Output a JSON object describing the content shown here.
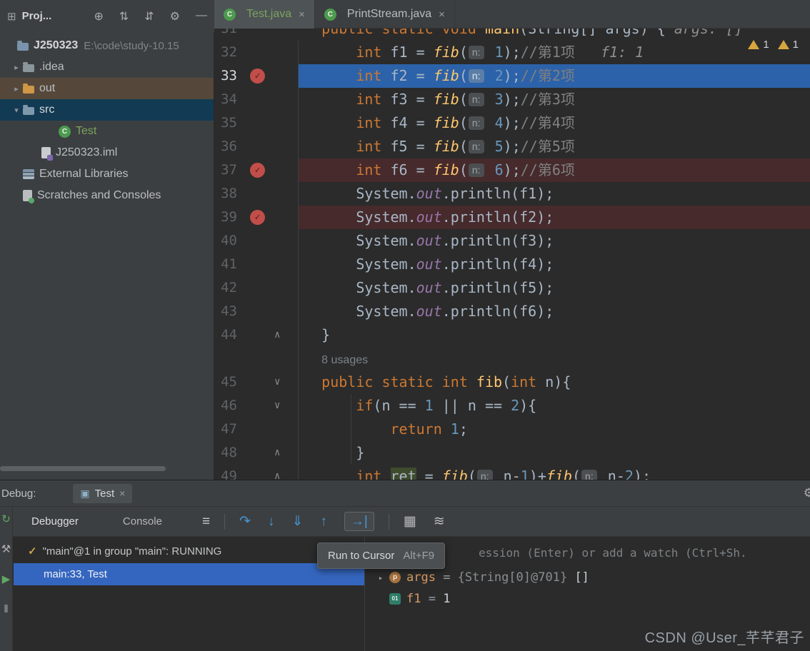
{
  "window": {
    "proj_glyph": "⊞",
    "proj_title": "Proj...",
    "proj_icons": [
      {
        "name": "locate-file-icon",
        "glyph": "⊕"
      },
      {
        "name": "expand-all-icon",
        "glyph": "⇅"
      },
      {
        "name": "collapse-all-icon",
        "glyph": "⇵"
      },
      {
        "name": "settings-gear-icon",
        "glyph": "⚙"
      },
      {
        "name": "hide-panel-icon",
        "glyph": "—"
      }
    ]
  },
  "project": {
    "rows": [
      {
        "id": "root",
        "indent": 6,
        "chevron": "",
        "icon": "folder",
        "iconColor": "#7a93ad",
        "label": "J250323",
        "labelClass": "root",
        "extra": "E:\\code\\study-10.15"
      },
      {
        "id": "idea",
        "indent": 14,
        "chevron": "▸",
        "icon": "folder",
        "iconColor": "#8a959c",
        "label": ".idea"
      },
      {
        "id": "out",
        "indent": 14,
        "chevron": "▸",
        "icon": "folder",
        "iconColor": "#cf9747",
        "label": "out",
        "bg": "#55483a"
      },
      {
        "id": "src",
        "indent": 14,
        "chevron": "▾",
        "icon": "folder",
        "iconColor": "#7f98ac",
        "label": "src",
        "bg": "#123a52",
        "labelColor": "#d8dadc"
      },
      {
        "id": "test-class",
        "indent": 64,
        "chevron": "",
        "icon": "class",
        "label": "Test",
        "labelColor": "#7ba45c"
      },
      {
        "id": "iml-file",
        "indent": 40,
        "chevron": "",
        "icon": "iml",
        "label": "J250323.iml"
      },
      {
        "id": "external-libraries",
        "indent": 14,
        "chevron": "",
        "icon": "lib",
        "label": "External Libraries"
      },
      {
        "id": "scratches",
        "indent": 14,
        "chevron": "",
        "icon": "scratch",
        "label": "Scratches and Consoles"
      }
    ]
  },
  "tabs": [
    {
      "label": "Test.java",
      "active": true,
      "labelColor": "#7ba45c"
    },
    {
      "label": "PrintStream.java",
      "active": false,
      "labelColor": "#b7bcc0"
    }
  ],
  "editor": {
    "close_glyph": "×",
    "inspections": [
      {
        "count": "1"
      },
      {
        "count": "1"
      }
    ],
    "lines": [
      {
        "num": "31",
        "tokens": [
          [
            "    ",
            "pl"
          ],
          [
            "public static void ",
            "kw"
          ],
          [
            "main",
            "decl"
          ],
          [
            "(String[] args) { ",
            "pl"
          ],
          [
            "args: []",
            "dbg"
          ]
        ]
      },
      {
        "num": "32",
        "tokens": [
          [
            "        ",
            "pl"
          ],
          [
            "int",
            "kw"
          ],
          [
            " f1 = ",
            "pl"
          ],
          [
            "fib",
            "call"
          ],
          [
            "(",
            "pl"
          ],
          [
            "n:",
            "chip"
          ],
          [
            " 1",
            "num"
          ],
          [
            ");",
            "pl"
          ],
          [
            "//第1项",
            "cm"
          ],
          [
            "   ",
            "pl"
          ],
          [
            "f1: 1",
            "dbg"
          ]
        ]
      },
      {
        "num": "33",
        "hl": "exec",
        "bp": true,
        "tokens": [
          [
            "        ",
            "pl"
          ],
          [
            "int",
            "kw"
          ],
          [
            " f2 = ",
            "pl"
          ],
          [
            "fib",
            "call"
          ],
          [
            "(",
            "pl"
          ],
          [
            "n:",
            "chip"
          ],
          [
            " 2",
            "num"
          ],
          [
            ");",
            "pl"
          ],
          [
            "//第2项",
            "cm"
          ]
        ]
      },
      {
        "num": "34",
        "tokens": [
          [
            "        ",
            "pl"
          ],
          [
            "int",
            "kw"
          ],
          [
            " f3 = ",
            "pl"
          ],
          [
            "fib",
            "call"
          ],
          [
            "(",
            "pl"
          ],
          [
            "n:",
            "chip"
          ],
          [
            " 3",
            "num"
          ],
          [
            ");",
            "pl"
          ],
          [
            "//第3项",
            "cm"
          ]
        ]
      },
      {
        "num": "35",
        "tokens": [
          [
            "        ",
            "pl"
          ],
          [
            "int",
            "kw"
          ],
          [
            " f4 = ",
            "pl"
          ],
          [
            "fib",
            "call"
          ],
          [
            "(",
            "pl"
          ],
          [
            "n:",
            "chip"
          ],
          [
            " 4",
            "num"
          ],
          [
            ");",
            "pl"
          ],
          [
            "//第4项",
            "cm"
          ]
        ]
      },
      {
        "num": "36",
        "tokens": [
          [
            "        ",
            "pl"
          ],
          [
            "int",
            "kw"
          ],
          [
            " f5 = ",
            "pl"
          ],
          [
            "fib",
            "call"
          ],
          [
            "(",
            "pl"
          ],
          [
            "n:",
            "chip"
          ],
          [
            " 5",
            "num"
          ],
          [
            ");",
            "pl"
          ],
          [
            "//第5项",
            "cm"
          ]
        ]
      },
      {
        "num": "37",
        "hl": "bp",
        "bp": true,
        "tokens": [
          [
            "        ",
            "pl"
          ],
          [
            "int",
            "kw"
          ],
          [
            " f6 = ",
            "pl"
          ],
          [
            "fib",
            "call"
          ],
          [
            "(",
            "pl"
          ],
          [
            "n:",
            "chip"
          ],
          [
            " 6",
            "num"
          ],
          [
            ");",
            "pl"
          ],
          [
            "//第6项",
            "cm"
          ]
        ]
      },
      {
        "num": "38",
        "tokens": [
          [
            "        ",
            "pl"
          ],
          [
            "System.",
            "pl"
          ],
          [
            "out",
            "field"
          ],
          [
            ".println(f1);",
            "pl"
          ]
        ]
      },
      {
        "num": "39",
        "hl": "bp",
        "bp": true,
        "tokens": [
          [
            "        ",
            "pl"
          ],
          [
            "System.",
            "pl"
          ],
          [
            "out",
            "field"
          ],
          [
            ".println(f2);",
            "pl"
          ]
        ]
      },
      {
        "num": "40",
        "tokens": [
          [
            "        ",
            "pl"
          ],
          [
            "System.",
            "pl"
          ],
          [
            "out",
            "field"
          ],
          [
            ".println(f3);",
            "pl"
          ]
        ]
      },
      {
        "num": "41",
        "tokens": [
          [
            "        ",
            "pl"
          ],
          [
            "System.",
            "pl"
          ],
          [
            "out",
            "field"
          ],
          [
            ".println(f4);",
            "pl"
          ]
        ]
      },
      {
        "num": "42",
        "tokens": [
          [
            "        ",
            "pl"
          ],
          [
            "System.",
            "pl"
          ],
          [
            "out",
            "field"
          ],
          [
            ".println(f5);",
            "pl"
          ]
        ]
      },
      {
        "num": "43",
        "tokens": [
          [
            "        ",
            "pl"
          ],
          [
            "System.",
            "pl"
          ],
          [
            "out",
            "field"
          ],
          [
            ".println(f6);",
            "pl"
          ]
        ]
      },
      {
        "num": "44",
        "fold": "end",
        "tokens": [
          [
            "    }",
            "pl"
          ]
        ]
      },
      {
        "num": "",
        "tokens": [
          [
            "    ",
            "pl"
          ],
          [
            "8 usages",
            "usages"
          ]
        ]
      },
      {
        "num": "45",
        "fold": "start",
        "tokens": [
          [
            "    ",
            "pl"
          ],
          [
            "public static int ",
            "kw"
          ],
          [
            "fib",
            "decl"
          ],
          [
            "(",
            "pl"
          ],
          [
            "int",
            "kw"
          ],
          [
            " n){",
            "pl"
          ]
        ]
      },
      {
        "num": "46",
        "fold": "start",
        "tokens": [
          [
            "        ",
            "pl"
          ],
          [
            "if",
            "kw"
          ],
          [
            "(n == ",
            "pl"
          ],
          [
            "1",
            "num"
          ],
          [
            " || n == ",
            "pl"
          ],
          [
            "2",
            "num"
          ],
          [
            "){",
            "pl"
          ]
        ]
      },
      {
        "num": "47",
        "tokens": [
          [
            "            ",
            "pl"
          ],
          [
            "return ",
            "kw"
          ],
          [
            "1",
            "num"
          ],
          [
            ";",
            "pl"
          ]
        ]
      },
      {
        "num": "48",
        "fold": "end",
        "tokens": [
          [
            "        }",
            "pl"
          ]
        ]
      },
      {
        "num": "49",
        "fold": "end",
        "tokens": [
          [
            "        ",
            "pl"
          ],
          [
            "int",
            "kw"
          ],
          [
            " ",
            "pl"
          ],
          [
            "ret",
            "hlid"
          ],
          [
            " = ",
            "pl"
          ],
          [
            "fib",
            "call"
          ],
          [
            "(",
            "pl"
          ],
          [
            "n:",
            "chip"
          ],
          [
            " n-",
            "pl"
          ],
          [
            "1",
            "num"
          ],
          [
            ")+",
            "pl"
          ],
          [
            "fib",
            "call"
          ],
          [
            "(",
            "pl"
          ],
          [
            "n:",
            "chip"
          ],
          [
            " n-",
            "pl"
          ],
          [
            "2",
            "num"
          ],
          [
            ");",
            "pl"
          ]
        ]
      }
    ]
  },
  "debug": {
    "label": "Debug:",
    "tab_icon": "▣",
    "tab_label": "Test",
    "close_glyph": "×",
    "gear_glyph": "⚙",
    "tabs": [
      {
        "label": "Debugger",
        "active": true
      },
      {
        "label": "Console",
        "active": false
      }
    ],
    "toolbar": [
      {
        "name": "layout-settings-icon",
        "glyph": "≡",
        "color": "#c6c8ca"
      },
      {
        "sep": true
      },
      {
        "name": "step-over-icon",
        "glyph": "↷",
        "color": "#4596d2"
      },
      {
        "name": "step-into-icon",
        "glyph": "↓",
        "color": "#4596d2"
      },
      {
        "name": "force-step-into-icon",
        "glyph": "⇓",
        "color": "#4596d2"
      },
      {
        "name": "step-out-icon",
        "glyph": "↑",
        "color": "#4596d2"
      },
      {
        "name": "run-to-cursor-icon",
        "glyph": "→|",
        "color": "#4596d2",
        "hover": true
      },
      {
        "sep": true
      },
      {
        "name": "view-breakpoints-icon",
        "glyph": "▦",
        "color": "#b8babc"
      },
      {
        "name": "mute-breakpoints-icon",
        "glyph": "≋",
        "color": "#b8babc"
      }
    ],
    "stripe_icons": [
      {
        "name": "rerun-icon",
        "glyph": "↻",
        "color": "#5fa865"
      },
      {
        "name": "build-icon",
        "glyph": "⚒",
        "color": "#a9abad"
      },
      {
        "name": "resume-icon",
        "glyph": "▶",
        "color": "#5fa865"
      },
      {
        "name": "pause-icon",
        "glyph": "‖",
        "color": "#a9abad"
      }
    ],
    "thread": {
      "check": "✓",
      "text": "\"main\"@1 in group \"main\": RUNNING"
    },
    "frame": {
      "text": "main:33, Test"
    },
    "watch_hint": "ession (Enter) or add a watch (Ctrl+Sh.",
    "variables": [
      {
        "icon": "param",
        "chevron": "▸",
        "name": "args",
        "eq": " = ",
        "type": "{String[0]@701}",
        "value": " []"
      },
      {
        "icon": "primitive",
        "chevron": "",
        "name": "f1",
        "eq": " = ",
        "type": "",
        "value": "1"
      }
    ],
    "tooltip": {
      "label": "Run to Cursor",
      "shortcut": "Alt+F9"
    }
  },
  "watermark": "CSDN @User_芊芊君子"
}
